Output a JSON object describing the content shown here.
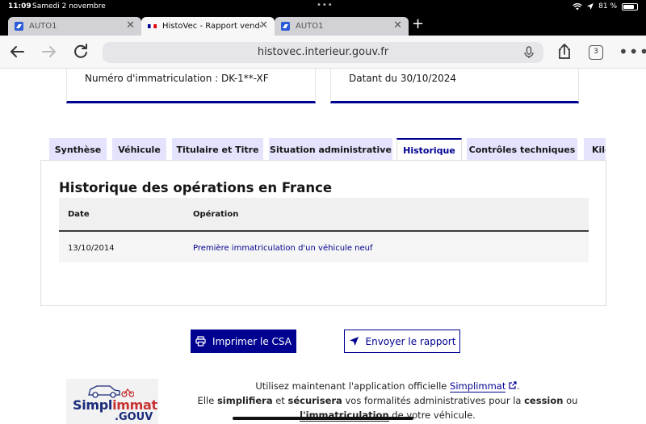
{
  "status_bar": {
    "time": "11:09",
    "date": "Samedi 2 novembre",
    "battery": "81 %"
  },
  "browser": {
    "tabs": [
      {
        "label": "AUTO1",
        "active": false
      },
      {
        "label": "HistoVec - Rapport vende",
        "active": true
      },
      {
        "label": "AUTO1",
        "active": false
      }
    ],
    "url": "histovec.interieur.gouv.fr",
    "tab_count": "3"
  },
  "cards": {
    "registration": "Numéro d'immatriculation : DK-1**-XF",
    "date": "Datant du 30/10/2024"
  },
  "report_tabs": [
    {
      "label": "Synthèse"
    },
    {
      "label": "Véhicule"
    },
    {
      "label": "Titulaire et Titre"
    },
    {
      "label": "Situation administrative"
    },
    {
      "label": "Historique"
    },
    {
      "label": "Contrôles techniques"
    },
    {
      "label": "Kilo"
    }
  ],
  "history": {
    "title": "Historique des opérations en France",
    "headers": {
      "date": "Date",
      "operation": "Opération"
    },
    "rows": [
      {
        "date": "13/10/2014",
        "operation": "Première immatriculation d'un véhicule neuf"
      }
    ]
  },
  "actions": {
    "print_label": "Imprimer le CSA",
    "send_label": "Envoyer le rapport"
  },
  "promo": {
    "logo_part1": "Simpl",
    "logo_part2": "immat",
    "logo_gouv": ".GOUV",
    "line1_prefix": "Utilisez maintenant l'application officielle ",
    "link": "Simplimmat",
    "line1_suffix": ".",
    "line2_a": "Elle ",
    "line2_b": "simplifiera",
    "line2_c": " et ",
    "line2_d": "sécurisera",
    "line2_e": " vos formalités administratives pour la ",
    "line2_f": "cession",
    "line2_g": " ou",
    "line3_a": "l'immatriculation",
    "line3_b": " de votre véhicule."
  },
  "colors": {
    "primary": "#000091",
    "tab_bg": "#e3e3fd"
  }
}
